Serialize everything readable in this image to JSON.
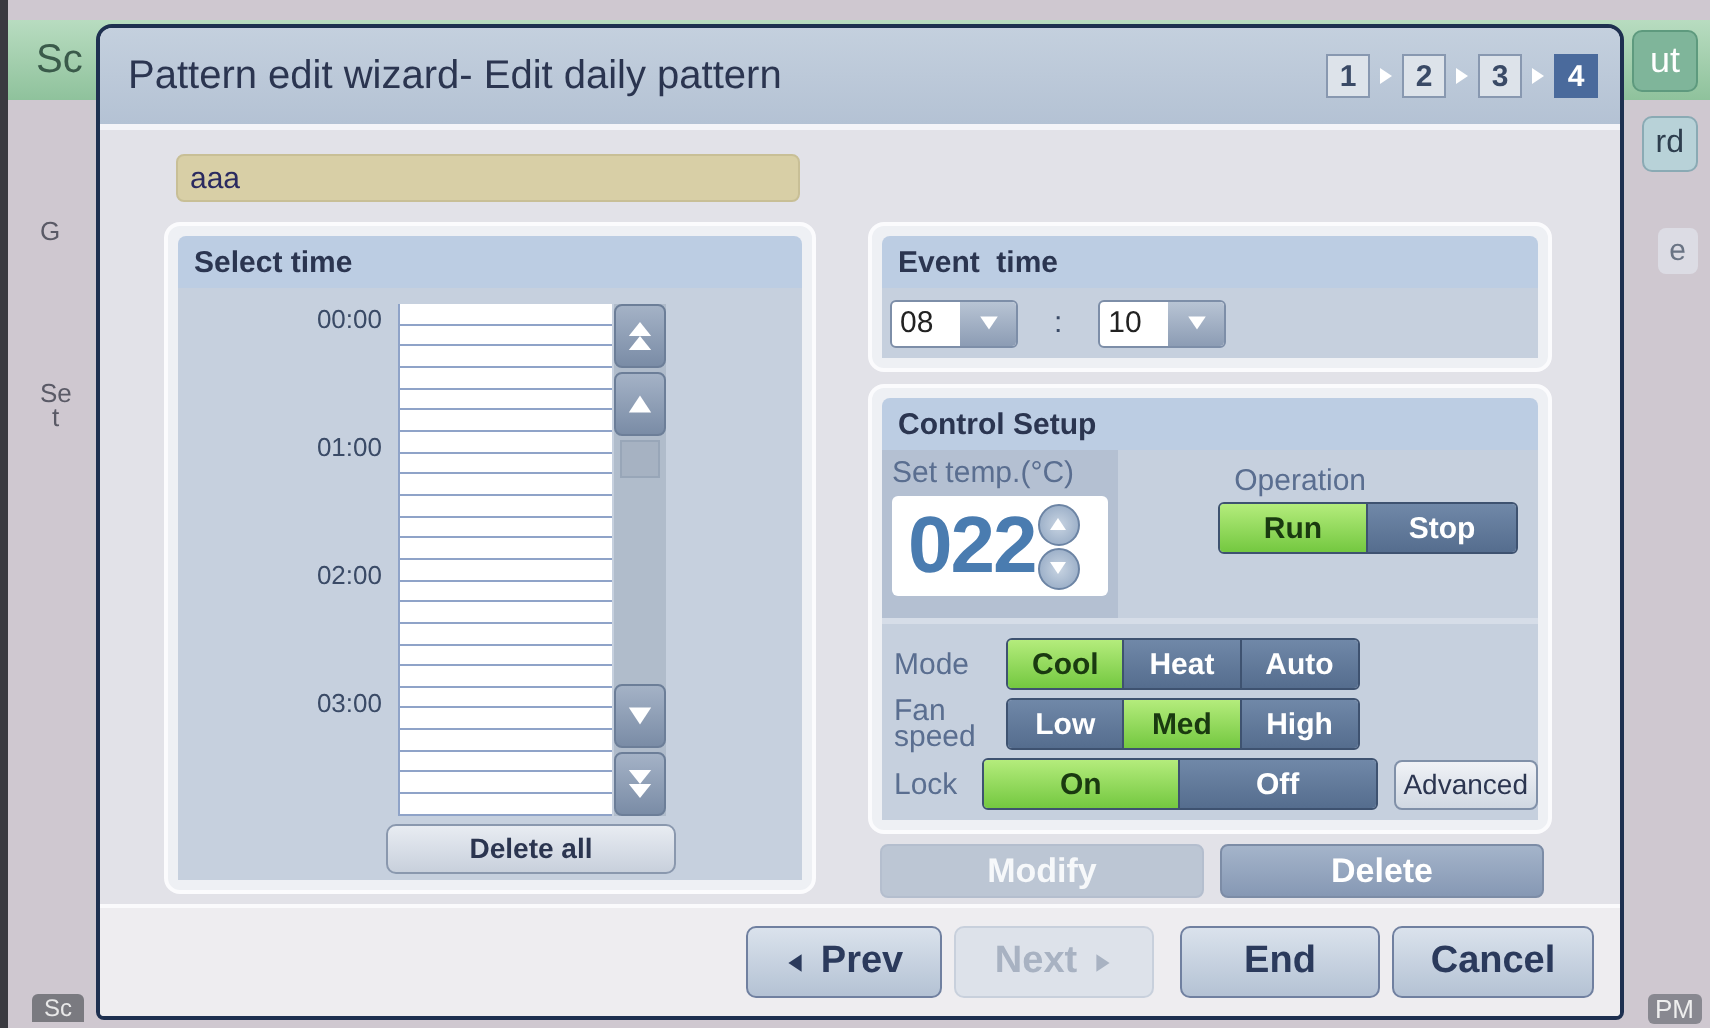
{
  "backdrop": {
    "title": "Sc",
    "top_button": "ut",
    "side_button": "rd",
    "left_labels": [
      "G",
      "Se",
      "t"
    ],
    "right_label": "e",
    "bottom_tab": "Sc",
    "clock": "PM"
  },
  "dialog": {
    "title": "Pattern edit wizard- Edit daily pattern",
    "steps": [
      {
        "label": "1",
        "selected": false
      },
      {
        "label": "2",
        "selected": false
      },
      {
        "label": "3",
        "selected": false
      },
      {
        "label": "4",
        "selected": true
      }
    ],
    "pattern_name": "aaa",
    "select_time": {
      "title": "Select time",
      "hours": [
        "00:00",
        "01:00",
        "02:00",
        "03:00"
      ],
      "delete_all": "Delete all"
    },
    "event_time": {
      "title": "Event  time",
      "hour": "08",
      "separator": ":",
      "minute": "10"
    },
    "control_setup": {
      "title": "Control Setup",
      "set_temp_label": "Set temp.(°C)",
      "set_temp": "022",
      "operation_label": "Operation",
      "operation": [
        {
          "label": "Run",
          "selected": true
        },
        {
          "label": "Stop",
          "selected": false
        }
      ],
      "settings": [
        {
          "label": "Mode",
          "options": [
            {
              "label": "Cool",
              "selected": true
            },
            {
              "label": "Heat",
              "selected": false
            },
            {
              "label": "Auto",
              "selected": false
            }
          ]
        },
        {
          "label": "Fan speed",
          "options": [
            {
              "label": "Low",
              "selected": false
            },
            {
              "label": "Med",
              "selected": true
            },
            {
              "label": "High",
              "selected": false
            }
          ]
        },
        {
          "label": "Lock",
          "options": [
            {
              "label": "On",
              "selected": true
            },
            {
              "label": "Off",
              "selected": false
            }
          ],
          "extra_button": "Advanced"
        }
      ]
    },
    "actions": [
      {
        "label": "Modify",
        "disabled": true
      },
      {
        "label": "Delete",
        "disabled": false
      }
    ],
    "nav": [
      {
        "label": "Prev",
        "kind": "back",
        "disabled": false
      },
      {
        "label": "Next",
        "kind": "forward",
        "disabled": true
      },
      {
        "label": "End",
        "kind": "plain",
        "disabled": false
      },
      {
        "label": "Cancel",
        "kind": "plain",
        "disabled": false
      }
    ]
  }
}
